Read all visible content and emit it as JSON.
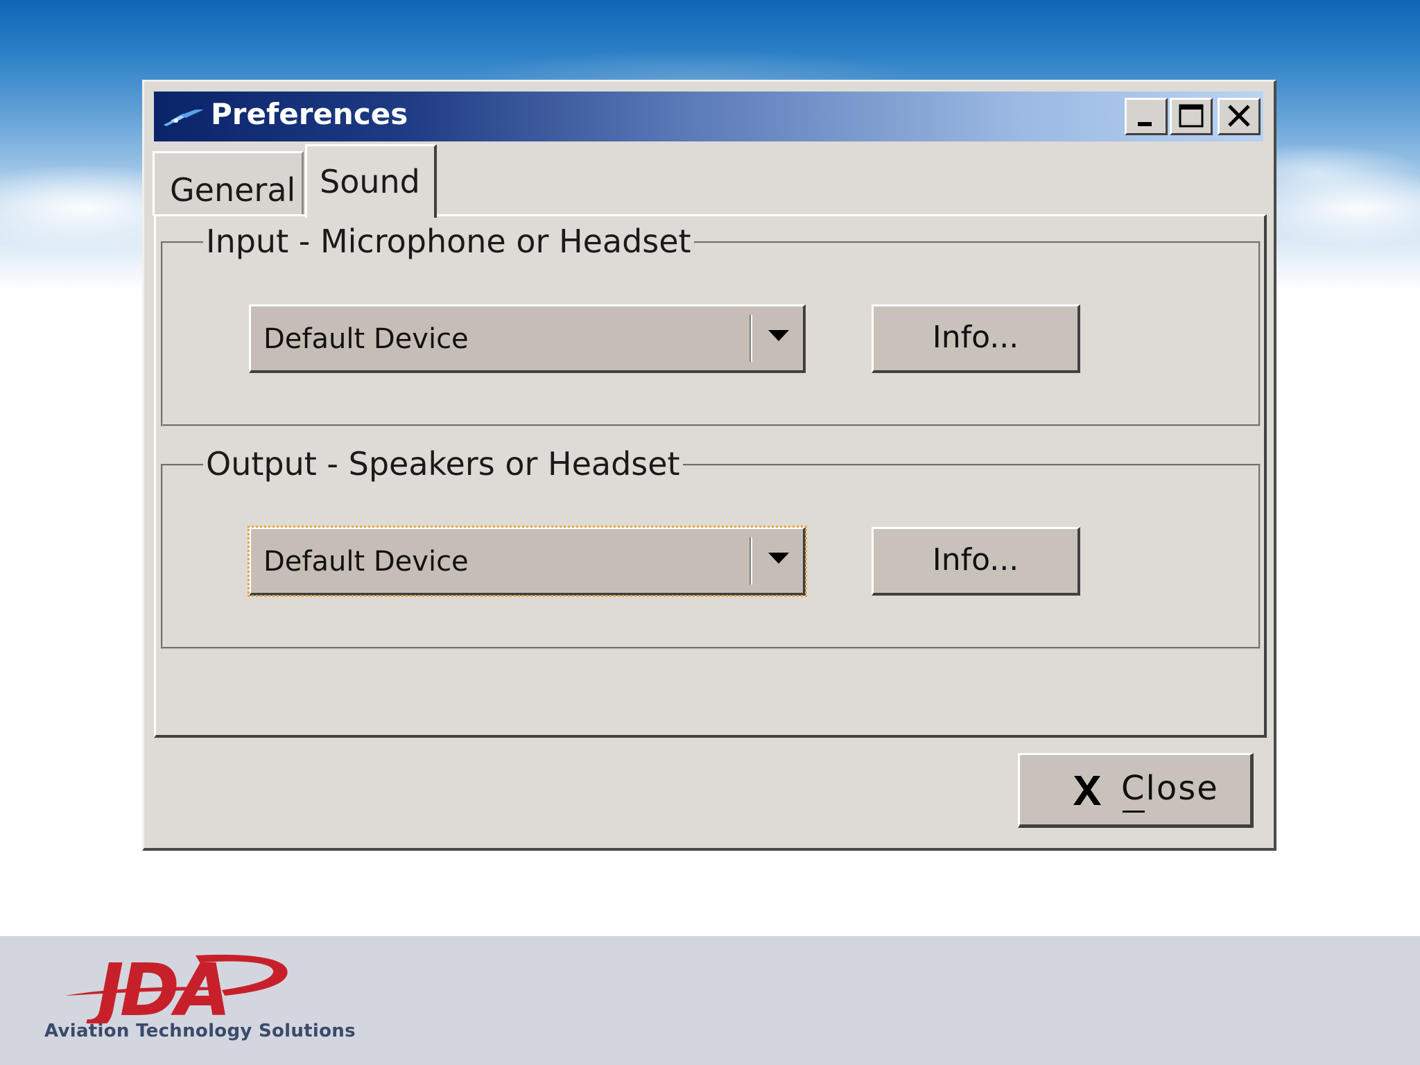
{
  "window": {
    "title": "Preferences",
    "controls": {
      "minimize_icon": "minimize-icon",
      "maximize_icon": "maximize-icon",
      "close_icon": "close-icon"
    }
  },
  "tabs": [
    {
      "label": "General",
      "selected": false
    },
    {
      "label": "Sound",
      "selected": true
    }
  ],
  "input_group": {
    "legend": "Input - Microphone or Headset",
    "device": "Default Device",
    "info_label": "Info..."
  },
  "output_group": {
    "legend": "Output - Speakers or Headset",
    "device": "Default Device",
    "info_label": "Info...",
    "focused": true
  },
  "footer_button": {
    "label": "Close",
    "icon": "close-x-icon"
  },
  "branding": {
    "logo_text": "JDA",
    "tagline": "Aviation Technology Solutions"
  },
  "colors": {
    "titlebar_start": "#0a246a",
    "titlebar_end": "#b9d3f2",
    "dialog_face": "#dedbd6",
    "logo_red": "#c8202a",
    "tagline": "#3b4a6b",
    "footer_band": "#d3d6df"
  }
}
